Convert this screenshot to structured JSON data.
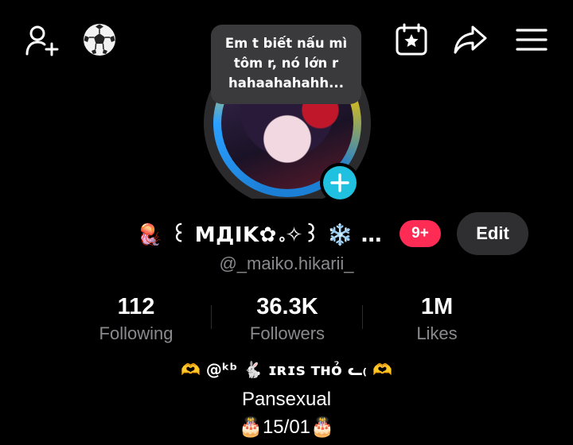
{
  "top_bar": {
    "add_friend_icon": "person-plus-icon",
    "soccer_icon": "soccer-ball-icon",
    "calendar_icon": "calendar-star-icon",
    "share_icon": "share-arrow-icon",
    "menu_icon": "hamburger-menu-icon"
  },
  "note_bubble": {
    "line1": "Em t biết nấu mì",
    "line2": "tôm r, nó lớn r",
    "line3": "hahaahahahh..."
  },
  "profile": {
    "display_name": "🪼 ꒰ МДIK✿｡✧꒱ ❄️ …",
    "notification_badge": "9+",
    "edit_label": "Edit",
    "handle": "@_maiko.hikarii_"
  },
  "stats": {
    "following": {
      "value": "112",
      "label": "Following"
    },
    "followers": {
      "value": "36.3K",
      "label": "Followers"
    },
    "likes": {
      "value": "1M",
      "label": "Likes"
    }
  },
  "bio": {
    "line1": "🫶 @ᵏᵇ 🐇 ɪʀɪꜱ ᴛʜỏ ᓚ₍ 🫶",
    "line2": "Pansexual",
    "line3": "🎂15/01🎂"
  },
  "colors": {
    "background": "#000000",
    "badge_red": "#fe2c55",
    "plus_cyan": "#20c0e0",
    "muted_text": "#8a8a8e",
    "button_bg": "#2f2f31"
  }
}
